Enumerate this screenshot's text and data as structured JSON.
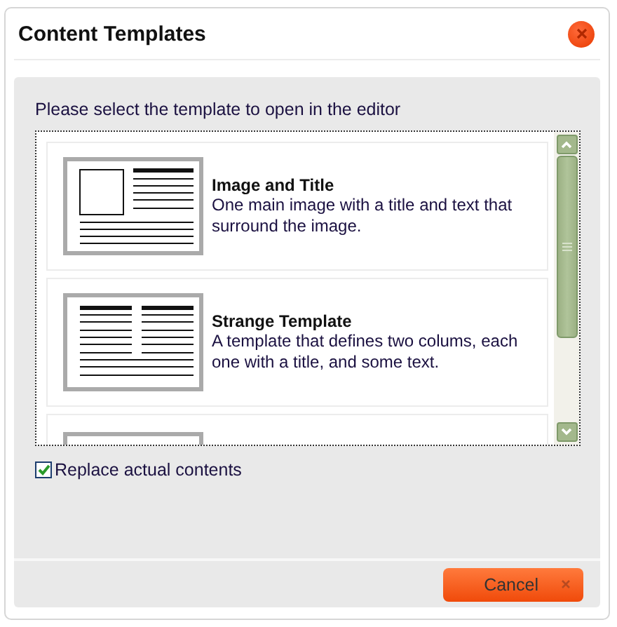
{
  "window": {
    "title": "Content Templates"
  },
  "instruction": "Please select the template to open in the editor",
  "templates": [
    {
      "kind": "image-title",
      "title": "Image and Title",
      "description": "One main image with a title and text that surround the image."
    },
    {
      "kind": "two-columns",
      "title": "Strange Template",
      "description": "A template that defines two colums, each one with a title, and some text."
    },
    {
      "kind": "blank"
    }
  ],
  "replace_contents": {
    "label": "Replace actual contents",
    "checked": true
  },
  "buttons": [
    {
      "label": "Cancel"
    }
  ]
}
